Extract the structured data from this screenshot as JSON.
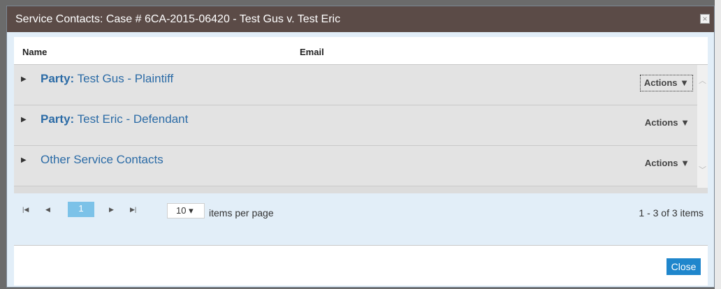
{
  "dialog": {
    "title": "Service Contacts: Case # 6CA-2015-06420 - Test Gus v. Test Eric",
    "close_icon": "×"
  },
  "grid": {
    "columns": {
      "name": "Name",
      "email": "Email"
    },
    "groups": [
      {
        "label_prefix": "Party:",
        "label": "Test Gus - Plaintiff",
        "actions": "Actions ▼"
      },
      {
        "label_prefix": "Party:",
        "label": "Test Eric - Defendant",
        "actions": "Actions ▼"
      },
      {
        "label_prefix": "",
        "label": "Other Service Contacts",
        "actions": "Actions ▼"
      }
    ]
  },
  "pager": {
    "first_icon": "|◀",
    "prev_icon": "◀",
    "current_page": "1",
    "next_icon": "▶",
    "last_icon": "▶|",
    "page_size": "10 ▾",
    "items_per_page_label": "items per page",
    "info": "1 - 3 of 3 items"
  },
  "footer": {
    "close_label": "Close"
  }
}
